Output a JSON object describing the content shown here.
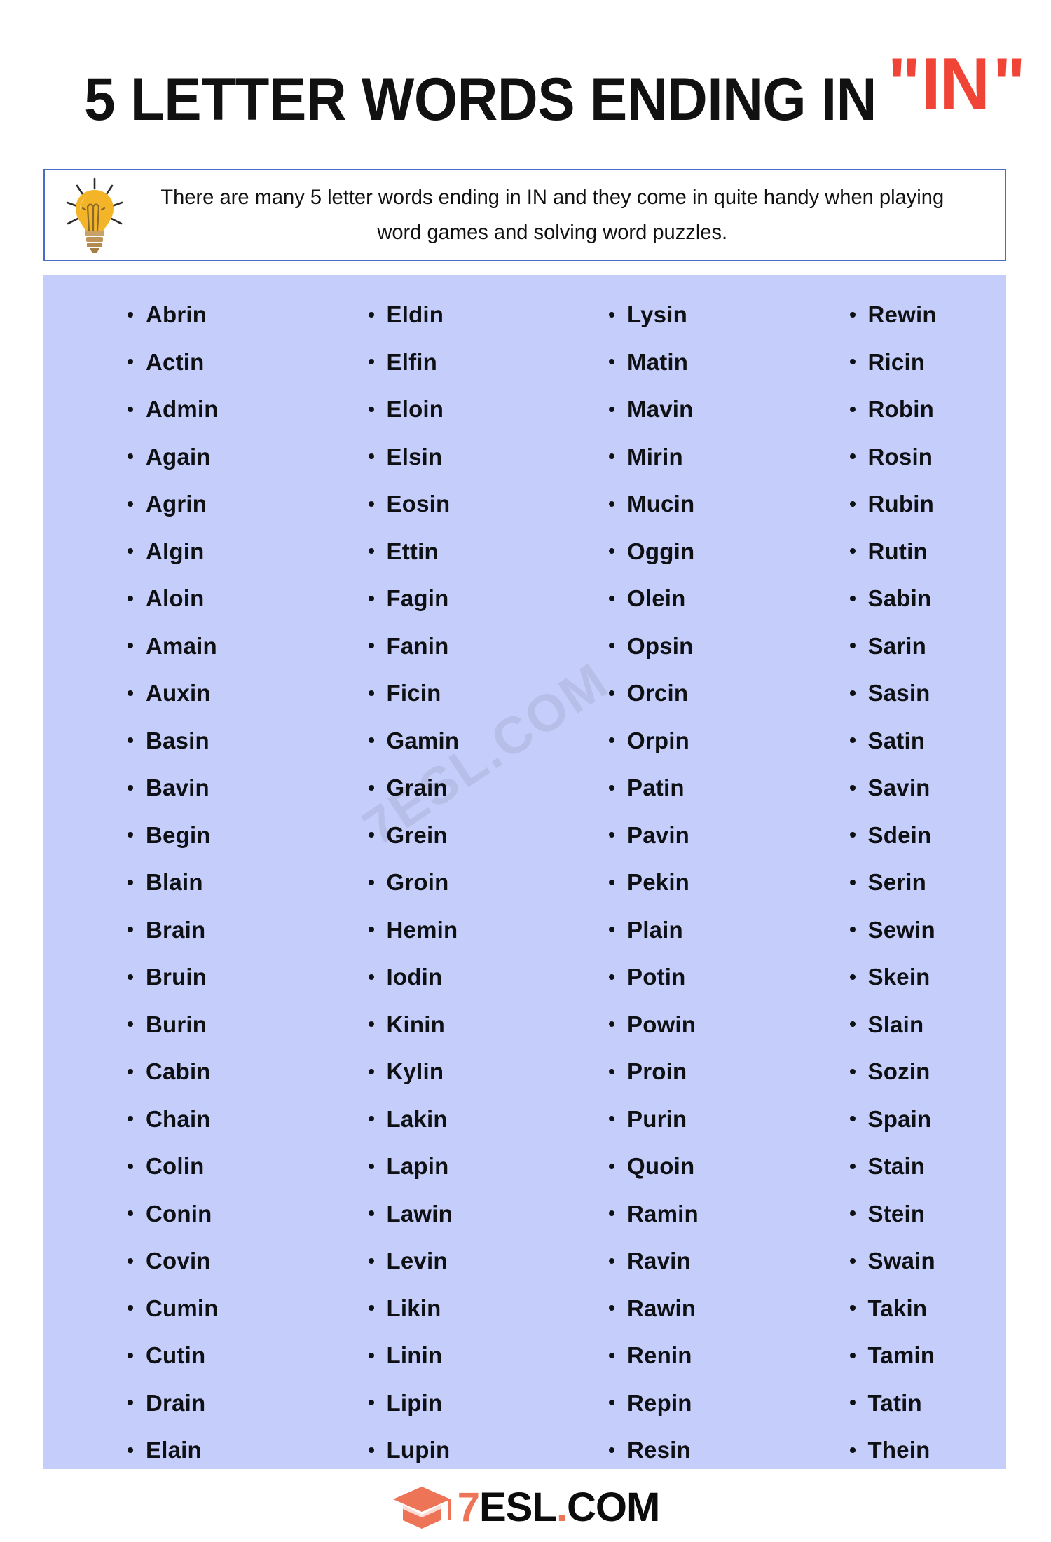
{
  "header": {
    "title_main": "5 LETTER WORDS ENDING IN",
    "title_quote_open": "\"",
    "title_accent": "IN",
    "title_quote_close": "\"",
    "accent_color": "#F04437"
  },
  "info": {
    "icon": "lightbulb-icon",
    "line1": "There are many 5 letter words ending in IN and they come in quite handy",
    "line2": "when playing word games and solving word puzzles.",
    "border_color": "#4A6BC6"
  },
  "word_panel": {
    "background_color": "#C5CDFA",
    "watermark": "7ESL.COM",
    "columns": [
      {
        "index": 1,
        "words": [
          "Abrin",
          "Actin",
          "Admin",
          "Again",
          "Agrin",
          "Algin",
          "Aloin",
          "Amain",
          "Auxin",
          "Basin",
          "Bavin",
          "Begin",
          "Blain",
          "Brain",
          "Bruin",
          "Burin",
          "Cabin",
          "Chain",
          "Colin",
          "Conin",
          "Covin",
          "Cumin",
          "Cutin",
          "Drain",
          "Elain"
        ]
      },
      {
        "index": 2,
        "words": [
          "Eldin",
          "Elfin",
          "Eloin",
          "Elsin",
          "Eosin",
          "Ettin",
          "Fagin",
          "Fanin",
          "Ficin",
          "Gamin",
          "Grain",
          "Grein",
          "Groin",
          "Hemin",
          "Iodin",
          "Kinin",
          "Kylin",
          "Lakin",
          "Lapin",
          "Lawin",
          "Levin",
          "Likin",
          "Linin",
          "Lipin",
          "Lupin"
        ]
      },
      {
        "index": 3,
        "words": [
          "Lysin",
          "Matin",
          "Mavin",
          "Mirin",
          "Mucin",
          "Oggin",
          "Olein",
          "Opsin",
          "Orcin",
          "Orpin",
          "Patin",
          "Pavin",
          "Pekin",
          "Plain",
          "Potin",
          "Powin",
          "Proin",
          "Purin",
          "Quoin",
          "Ramin",
          "Ravin",
          "Rawin",
          "Renin",
          "Repin",
          "Resin"
        ]
      },
      {
        "index": 4,
        "words": [
          "Rewin",
          "Ricin",
          "Robin",
          "Rosin",
          "Rubin",
          "Rutin",
          "Sabin",
          "Sarin",
          "Sasin",
          "Satin",
          "Savin",
          "Sdein",
          "Serin",
          "Sewin",
          "Skein",
          "Slain",
          "Sozin",
          "Spain",
          "Stain",
          "Stein",
          "Swain",
          "Takin",
          "Tamin",
          "Tatin",
          "Thein"
        ]
      }
    ]
  },
  "footer": {
    "logo_icon": "graduation-cap-icon",
    "logo_seven": "7",
    "logo_esl": "ESL",
    "logo_dot": ".",
    "logo_com": "COM",
    "logo_accent_color": "#EE7458"
  }
}
